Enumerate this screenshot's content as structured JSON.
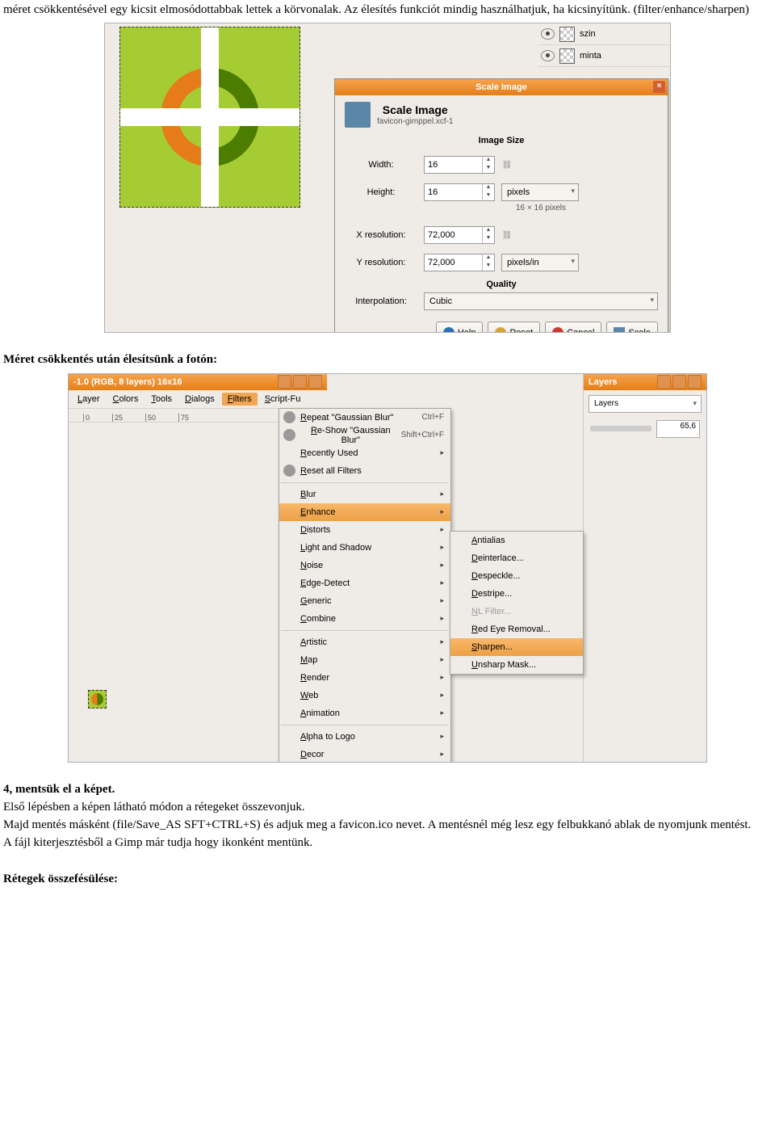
{
  "text": {
    "p1": "méret csökkentésével egy kicsit elmosódottabbak lettek a körvonalak. Az élesítés funkciót mindig használhatjuk, ha kicsinyítünk. (filter/enhance/sharpen)",
    "h2": "Méret csökkentés után élesítsünk a fotón:",
    "h3": "4, mentsük el a képet.",
    "p3": "Első lépésben a képen látható módon a rétegeket összevonjuk.",
    "p4": "Majd mentés másként (file/Save_AS SFT+CTRL+S) és adjuk meg a favicon.ico nevet. A mentésnél még lesz egy felbukkanó ablak de nyomjunk mentést.",
    "p5": "A fájl kiterjesztésből a Gimp már tudja hogy ikonként mentünk.",
    "h4": "Rétegek összefésülése:"
  },
  "ss1": {
    "layers": [
      {
        "name": "szin"
      },
      {
        "name": "minta"
      }
    ],
    "dialog": {
      "title": "Scale Image",
      "heading": "Scale Image",
      "subfile": "favicon-gimppel.xcf-1",
      "sec_size": "Image Size",
      "width_lbl": "Width:",
      "width_val": "16",
      "height_lbl": "Height:",
      "height_val": "16",
      "units": "pixels",
      "pxnote": "16 × 16 pixels",
      "xres_lbl": "X resolution:",
      "xres_val": "72,000",
      "yres_lbl": "Y resolution:",
      "yres_val": "72,000",
      "res_units": "pixels/in",
      "sec_q": "Quality",
      "interp_lbl": "Interpolation:",
      "interp_val": "Cubic",
      "btn_help": "Help",
      "btn_reset": "Reset",
      "btn_cancel": "Cancel",
      "btn_scale": "Scale"
    }
  },
  "ss2": {
    "wintitle": "-1.0 (RGB, 8 layers) 16x16",
    "menubar": [
      "Layer",
      "Colors",
      "Tools",
      "Dialogs",
      "Filters",
      "Script-Fu"
    ],
    "ruler": [
      "0",
      "25",
      "50",
      "75"
    ],
    "layers_title": "Layers",
    "layers_combo": "Layers",
    "opacity_val": "65,6",
    "menu1": [
      {
        "t": "Repeat \"Gaussian Blur\"",
        "sc": "Ctrl+F",
        "ic": "gear"
      },
      {
        "t": "Re-Show \"Gaussian Blur\"",
        "sc": "Shift+Ctrl+F",
        "ic": "gear"
      },
      {
        "t": "Recently Used",
        "ar": true
      },
      {
        "t": "Reset all Filters",
        "ic": "gear"
      },
      {
        "sep": true
      },
      {
        "t": "Blur",
        "ar": true
      },
      {
        "t": "Enhance",
        "ar": true,
        "hl": true
      },
      {
        "t": "Distorts",
        "ar": true
      },
      {
        "t": "Light and Shadow",
        "ar": true
      },
      {
        "t": "Noise",
        "ar": true
      },
      {
        "t": "Edge-Detect",
        "ar": true
      },
      {
        "t": "Generic",
        "ar": true
      },
      {
        "t": "Combine",
        "ar": true
      },
      {
        "sep": true
      },
      {
        "t": "Artistic",
        "ar": true
      },
      {
        "t": "Map",
        "ar": true
      },
      {
        "t": "Render",
        "ar": true
      },
      {
        "t": "Web",
        "ar": true
      },
      {
        "t": "Animation",
        "ar": true
      },
      {
        "sep": true
      },
      {
        "t": "Alpha to Logo",
        "ar": true
      },
      {
        "t": "Decor",
        "ar": true
      }
    ],
    "menu2": [
      {
        "t": "Antialias"
      },
      {
        "t": "Deinterlace..."
      },
      {
        "t": "Despeckle..."
      },
      {
        "t": "Destripe..."
      },
      {
        "t": "NL Filter...",
        "dis": true
      },
      {
        "t": "Red Eye Removal..."
      },
      {
        "t": "Sharpen...",
        "hl": true
      },
      {
        "t": "Unsharp Mask..."
      }
    ]
  }
}
